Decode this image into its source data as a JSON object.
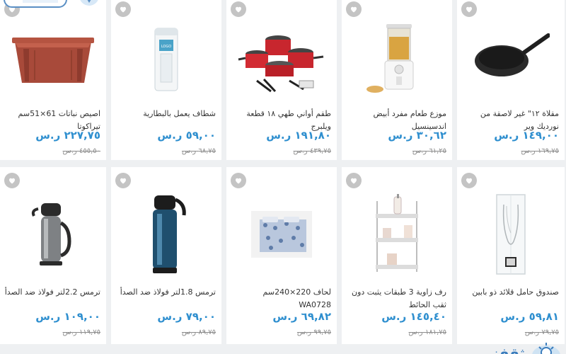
{
  "currency": "ر.س",
  "colors": {
    "price": "#2f8fcf",
    "old_price": "#8a8a8a",
    "fav": "#c4c4c4",
    "background": "#eef0f2"
  },
  "watermark": {
    "text": "ثقفني",
    "icon": "lightbulb-icon"
  },
  "products": [
    {
      "name": "اصيص نباتات 61×51سم تيراكوتا",
      "price": "٢٢٧,٧٥",
      "old_price": "٤٥٥,٥٠",
      "image": "planter-tray"
    },
    {
      "name": "شطاف يعمل بالبطارية",
      "price": "٥٩,٠٠",
      "old_price": "٦٨,٧٥",
      "image": "battery-bidet"
    },
    {
      "name": "طقم أواني طهي ١٨ قطعة ويلبرج",
      "price": "١٩١,٨٠",
      "old_price": "٤٣٩,٧٥",
      "image": "cookware-set"
    },
    {
      "name": "موزع طعام مفرد أبيض اندسينسيل",
      "price": "٣٠,٦٢",
      "old_price": "٦١,٢٥",
      "image": "cereal-dispenser"
    },
    {
      "name": "مقلاة ١٢\" غير لاصقة من نورديك وير",
      "price": "١٤٩,٠٠",
      "old_price": "١٦٩,٧٥",
      "image": "frying-pan"
    },
    {
      "name": "ترمس 2.2لتر فولاذ ضد الصدأ",
      "price": "١٠٩,٠٠",
      "old_price": "١١٩,٧٥",
      "image": "steel-thermos"
    },
    {
      "name": "ترمس 1.8لتر فولاذ ضد الصدأ",
      "price": "٧٩,٠٠",
      "old_price": "٨٩,٧٥",
      "image": "blue-thermos"
    },
    {
      "name": "لحاف 220×240سم WA0728",
      "price": "٦٩,٨٢",
      "old_price": "٩٩,٧٥",
      "image": "bed-quilt"
    },
    {
      "name": "رف زاوية 3 طبقات يثبت دون ثقب الحائط",
      "price": "١٤٥,٤٠",
      "old_price": "١٨١,٧٥",
      "image": "corner-shelf"
    },
    {
      "name": "صندوق حامل قلائد ذو بابين",
      "price": "٥٩,٨١",
      "old_price": "٧٩,٧٥",
      "image": "necklace-box"
    }
  ]
}
